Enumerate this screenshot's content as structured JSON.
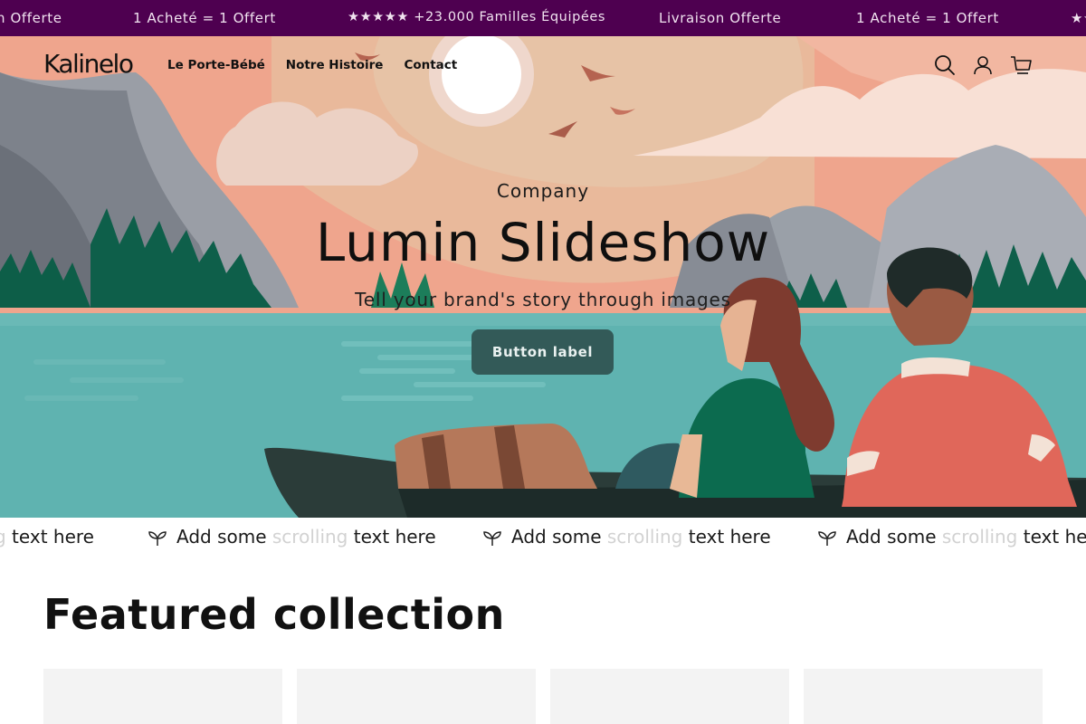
{
  "announcement": {
    "items": [
      "n Offerte",
      "1 Acheté = 1 Offert",
      "★★★★★ +23.000 Familles Équipées",
      "Livraison Offerte",
      "1 Acheté = 1 Offert",
      "★★"
    ],
    "background": "#4e0050"
  },
  "header": {
    "logo": "Kalinelo",
    "nav": [
      "Le Porte-Bébé",
      "Notre Histoire",
      "Contact"
    ],
    "icons": [
      "search-icon",
      "account-icon",
      "cart-icon"
    ]
  },
  "hero": {
    "eyebrow": "Company",
    "headline": "Lumin Slideshow",
    "subline": "Tell your brand's story through images",
    "button_label": "Button label",
    "button_color": "#335a58"
  },
  "scroller": {
    "segments": [
      {
        "pre": "",
        "ghost": "g",
        "post": " text here"
      },
      {
        "pre": "Add some ",
        "ghost": "scrolling",
        "post": " text here"
      },
      {
        "pre": "Add some ",
        "ghost": "scrolling",
        "post": " text here"
      },
      {
        "pre": "Add some ",
        "ghost": "scrolling",
        "post": " text he"
      }
    ],
    "icon": "leaf-sprout-icon"
  },
  "featured": {
    "title": "Featured collection",
    "cards": 4
  }
}
